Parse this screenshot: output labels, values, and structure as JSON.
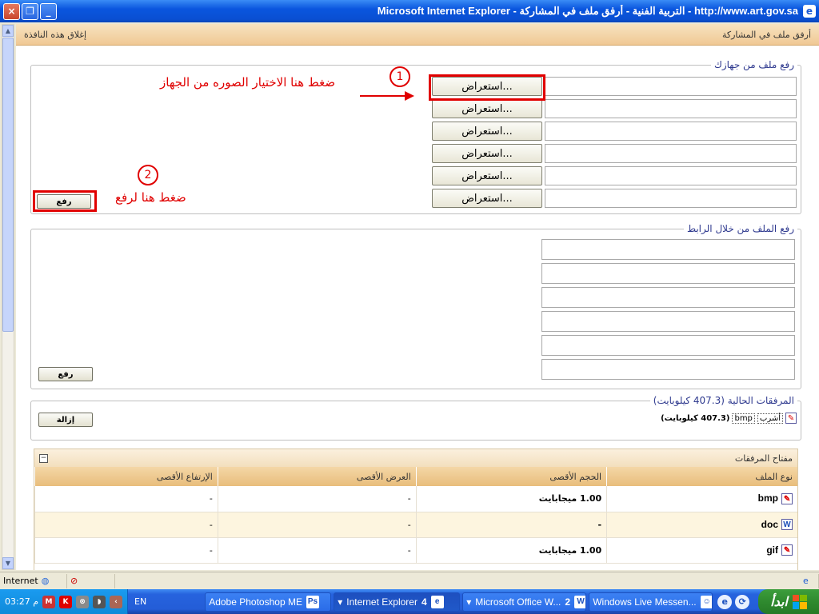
{
  "window": {
    "title": "Microsoft Internet Explorer - التربية الفنية - أرفق ملف في المشاركة - http://www.art.gov.sa",
    "buttons": {
      "close": "×",
      "restore": "❐",
      "minimize": "_"
    }
  },
  "page": {
    "header_right": "أرفق ملف في المشاركة",
    "header_left": "إغلاق هذه النافذة"
  },
  "upload_local": {
    "legend": "رفع ملف من جهازك",
    "browse_label": "استعراض...",
    "upload_button": "رفع",
    "rows": 6
  },
  "annotations": {
    "num1": "1",
    "text1": "ضغط هنا الاختيار الصوره من الجهاز",
    "num2": "2",
    "text2": "ضغط هنا لرفع"
  },
  "upload_url": {
    "legend": "رفع الملف من خلال الرابط",
    "upload_button": "رفع"
  },
  "current_attachments": {
    "legend": "المرفقات الحالية (407.3 كيلوبايت)",
    "remove_button": "إزالة",
    "item_name": "أشرب",
    "item_ext": "bmp",
    "item_size": "(407.3 كيلوبايت)"
  },
  "attachment_key": {
    "title": "مفتاح المرفقات",
    "collapse": "−",
    "columns": [
      "نوع الملف",
      "الحجم الأقصى",
      "العرض الأقصى",
      "الإرتفاع الأقصى"
    ],
    "rows": [
      {
        "type": "bmp",
        "size": "1.00 ميجابايت",
        "width": "-",
        "height": "-"
      },
      {
        "type": "doc",
        "size": "-",
        "width": "-",
        "height": "-"
      },
      {
        "type": "gif",
        "size": "1.00 ميجابايت",
        "width": "-",
        "height": "-"
      }
    ]
  },
  "statusbar": {
    "zone": "Internet"
  },
  "taskbar": {
    "start": "ابدأ",
    "tasks": [
      {
        "label": "Windows Live Messen...",
        "count": ""
      },
      {
        "label": "Microsoft Office W...",
        "count": "2"
      },
      {
        "label": "Internet Explorer",
        "count": "4"
      },
      {
        "label": "Adobe Photoshop ME",
        "count": ""
      }
    ],
    "lang": "EN",
    "clock": "03:27 م"
  }
}
